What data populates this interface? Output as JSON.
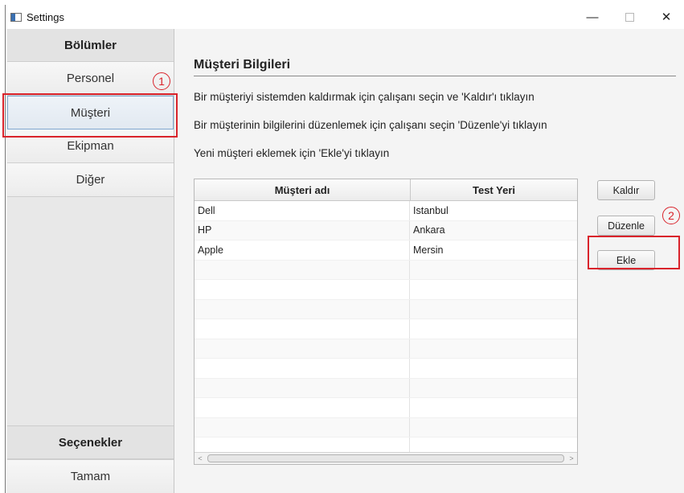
{
  "window": {
    "title": "Settings"
  },
  "sidebar": {
    "sections_header": "Bölümler",
    "items": [
      {
        "label": "Personel"
      },
      {
        "label": "Müşteri"
      },
      {
        "label": "Ekipman"
      },
      {
        "label": "Diğer"
      }
    ],
    "options_header": "Seçenekler",
    "ok_label": "Tamam"
  },
  "main": {
    "title": "Müşteri Bilgileri",
    "instructions": [
      "Bir müşteriyi sistemden kaldırmak için çalışanı seçin ve 'Kaldır'ı tıklayın",
      "Bir müşterinin bilgilerini düzenlemek için çalışanı seçin 'Düzenle'yi tıklayın",
      "Yeni müşteri eklemek için 'Ekle'yi tıklayın"
    ],
    "table": {
      "columns": [
        "Müşteri adı",
        "Test Yeri"
      ],
      "rows": [
        [
          "Dell",
          "Istanbul"
        ],
        [
          "HP",
          "Ankara"
        ],
        [
          "Apple",
          "Mersin"
        ]
      ]
    },
    "buttons": {
      "remove": "Kaldır",
      "edit": "Düzenle",
      "add": "Ekle"
    }
  },
  "annotations": {
    "callout_1": "1",
    "callout_2": "2",
    "color": "#d9232b"
  }
}
